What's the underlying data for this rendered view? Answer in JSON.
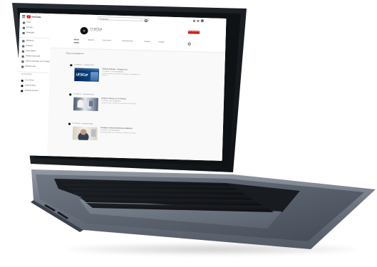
{
  "window": {
    "app_name": "YouTube",
    "search_placeholder": "Pesquisar"
  },
  "sidebar": {
    "items": [
      {
        "label": "Início",
        "icon": "home-icon"
      },
      {
        "label": "Em alta",
        "icon": "fire-icon"
      },
      {
        "label": "Inscrições",
        "icon": "subscriptions-icon"
      },
      {
        "label": "Biblioteca",
        "icon": "library-icon"
      },
      {
        "label": "Histórico",
        "icon": "history-icon"
      },
      {
        "label": "Seus vídeos",
        "icon": "video-icon"
      },
      {
        "label": "Assistir mais tarde",
        "icon": "clock-icon"
      },
      {
        "label": "Vídeos marcados com \"Gostei\"",
        "icon": "thumb-up-icon"
      },
      {
        "label": "Mostrar mais",
        "icon": "chevron-down-icon"
      }
    ],
    "section_label": "INSCRIÇÕES",
    "subscriptions": [
      {
        "label": "TV UFSCar"
      },
      {
        "label": "Canal UFSCar"
      },
      {
        "label": "Jornal da UFSCar"
      }
    ]
  },
  "channel": {
    "logo_text": "tv",
    "name": "TV UFSCar",
    "subscribers": "5,2 mil inscritos",
    "subscribe_label": "INSCREVER-SE",
    "tabs": [
      "INÍCIO",
      "VÍDEOS",
      "PLAYLISTS",
      "COMUNIDADE",
      "CANAIS",
      "SOBRE"
    ],
    "filter_label": "Todas as postagens ▾"
  },
  "feed": [
    {
      "header": "TV UFSCar · 1 semana atrás",
      "thumb_title": "UFSCar",
      "thumb_subtitle": "Universidade Federal",
      "title": "UFSCar Notícias · Programa 10",
      "meta": "TV UFSCar · 1,2 mil visualizações",
      "desc": "Confira as principais notícias da universidade e os destaques da semana."
    },
    {
      "header": "TV UFSCar · 2 semanas atrás",
      "title": "UFSCar Ciência na TV UFSCar",
      "meta": "TV UFSCar · 842 visualizações",
      "desc": "Pesquisa, ensino e extensão em reportagens da TV UFSCar."
    },
    {
      "header": "TV UFSCar · 3 semanas atrás",
      "title": "Inovação e Desenvolvimento Acadêmico",
      "meta": "TV UFSCar · 631 visualizações",
      "desc": "Entrevista especial com convidados e professores da UFSCar."
    }
  ],
  "colors": {
    "brand_red": "#cc0000",
    "laptop_body": "#7d8591",
    "laptop_dark": "#2d3138",
    "screen_bezel": "#171a1f"
  }
}
